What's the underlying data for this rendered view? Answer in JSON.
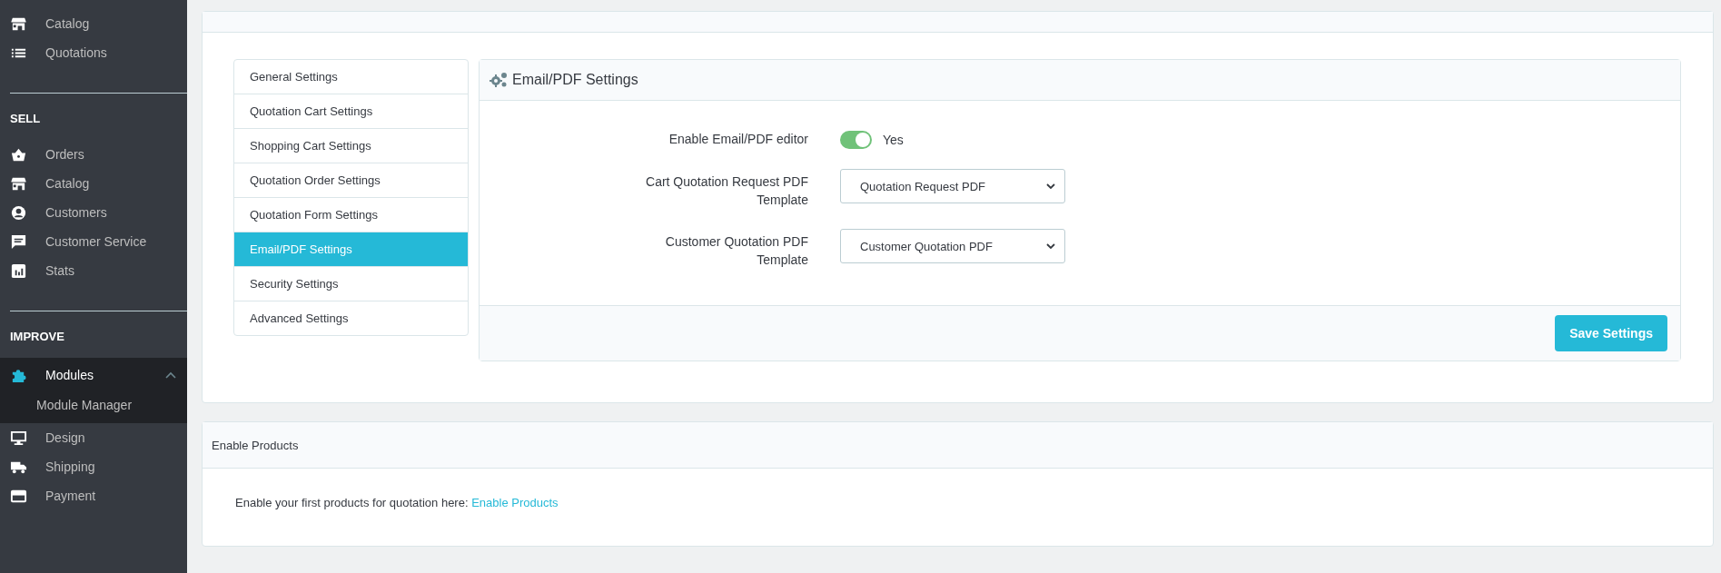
{
  "sidebar": {
    "sections": [
      {
        "items": [
          {
            "label": "Catalog",
            "selected": false
          },
          {
            "label": "Quotations",
            "selected": false
          }
        ]
      },
      {
        "heading": "SELL",
        "items": [
          {
            "label": "Orders",
            "selected": false
          },
          {
            "label": "Catalog",
            "selected": false
          },
          {
            "label": "Customers",
            "selected": false
          },
          {
            "label": "Customer Service",
            "selected": false
          },
          {
            "label": "Stats",
            "selected": false
          }
        ]
      },
      {
        "heading": "IMPROVE",
        "items": [
          {
            "label": "Modules",
            "selected": true,
            "expanded": true,
            "children": [
              {
                "label": "Module Manager",
                "selected": false
              }
            ]
          },
          {
            "label": "Design",
            "selected": false
          },
          {
            "label": "Shipping",
            "selected": false
          },
          {
            "label": "Payment",
            "selected": false
          }
        ]
      }
    ]
  },
  "settings_menu": [
    {
      "label": "General Settings",
      "selected": false
    },
    {
      "label": "Quotation Cart Settings",
      "selected": false
    },
    {
      "label": "Shopping Cart Settings",
      "selected": false
    },
    {
      "label": "Quotation Order Settings",
      "selected": false
    },
    {
      "label": "Quotation Form Settings",
      "selected": false
    },
    {
      "label": "Email/PDF Settings",
      "selected": true
    },
    {
      "label": "Security Settings",
      "selected": false
    },
    {
      "label": "Advanced Settings",
      "selected": false
    }
  ],
  "panel": {
    "title": "Email/PDF Settings",
    "fields": [
      {
        "kind": "toggle",
        "label": "Enable Email/PDF editor",
        "on": true,
        "value": "Yes"
      },
      {
        "kind": "select",
        "label": "Cart Quotation Request PDF Template",
        "value": "Quotation Request PDF"
      },
      {
        "kind": "select",
        "label": "Customer Quotation PDF Template",
        "value": "Customer Quotation PDF"
      }
    ],
    "button": "Save Settings"
  },
  "enable_products": {
    "title": "Enable Products",
    "text": "Enable your first products for quotation here:",
    "link": "Enable Products"
  }
}
